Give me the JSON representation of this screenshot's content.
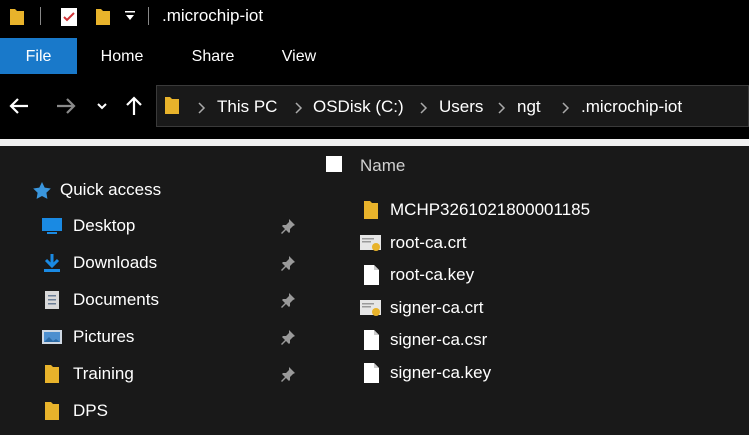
{
  "window": {
    "title": ".microchip-iot"
  },
  "ribbon": {
    "tabs": [
      "File",
      "Home",
      "Share",
      "View"
    ]
  },
  "address": {
    "crumbs": [
      "This PC",
      "OSDisk (C:)",
      "Users",
      "ngt",
      ".microchip-iot"
    ]
  },
  "nav": {
    "quick_access": "Quick access",
    "items": [
      {
        "label": "Desktop",
        "icon": "desktop-icon",
        "pinned": true
      },
      {
        "label": "Downloads",
        "icon": "download-icon",
        "pinned": true
      },
      {
        "label": "Documents",
        "icon": "documents-icon",
        "pinned": true
      },
      {
        "label": "Pictures",
        "icon": "pictures-icon",
        "pinned": true
      },
      {
        "label": "Training",
        "icon": "folder-icon",
        "pinned": true
      },
      {
        "label": "DPS",
        "icon": "folder-icon",
        "pinned": false
      }
    ]
  },
  "files": {
    "column_name": "Name",
    "items": [
      {
        "name": "MCHP3261021800001185",
        "icon": "folder-icon"
      },
      {
        "name": "root-ca.crt",
        "icon": "certificate-icon"
      },
      {
        "name": "root-ca.key",
        "icon": "file-icon"
      },
      {
        "name": "signer-ca.crt",
        "icon": "certificate-icon"
      },
      {
        "name": "signer-ca.csr",
        "icon": "file-icon"
      },
      {
        "name": "signer-ca.key",
        "icon": "file-icon"
      }
    ]
  },
  "colors": {
    "accent": "#1979ca",
    "folder": "#e8b32b",
    "background": "#191919"
  }
}
